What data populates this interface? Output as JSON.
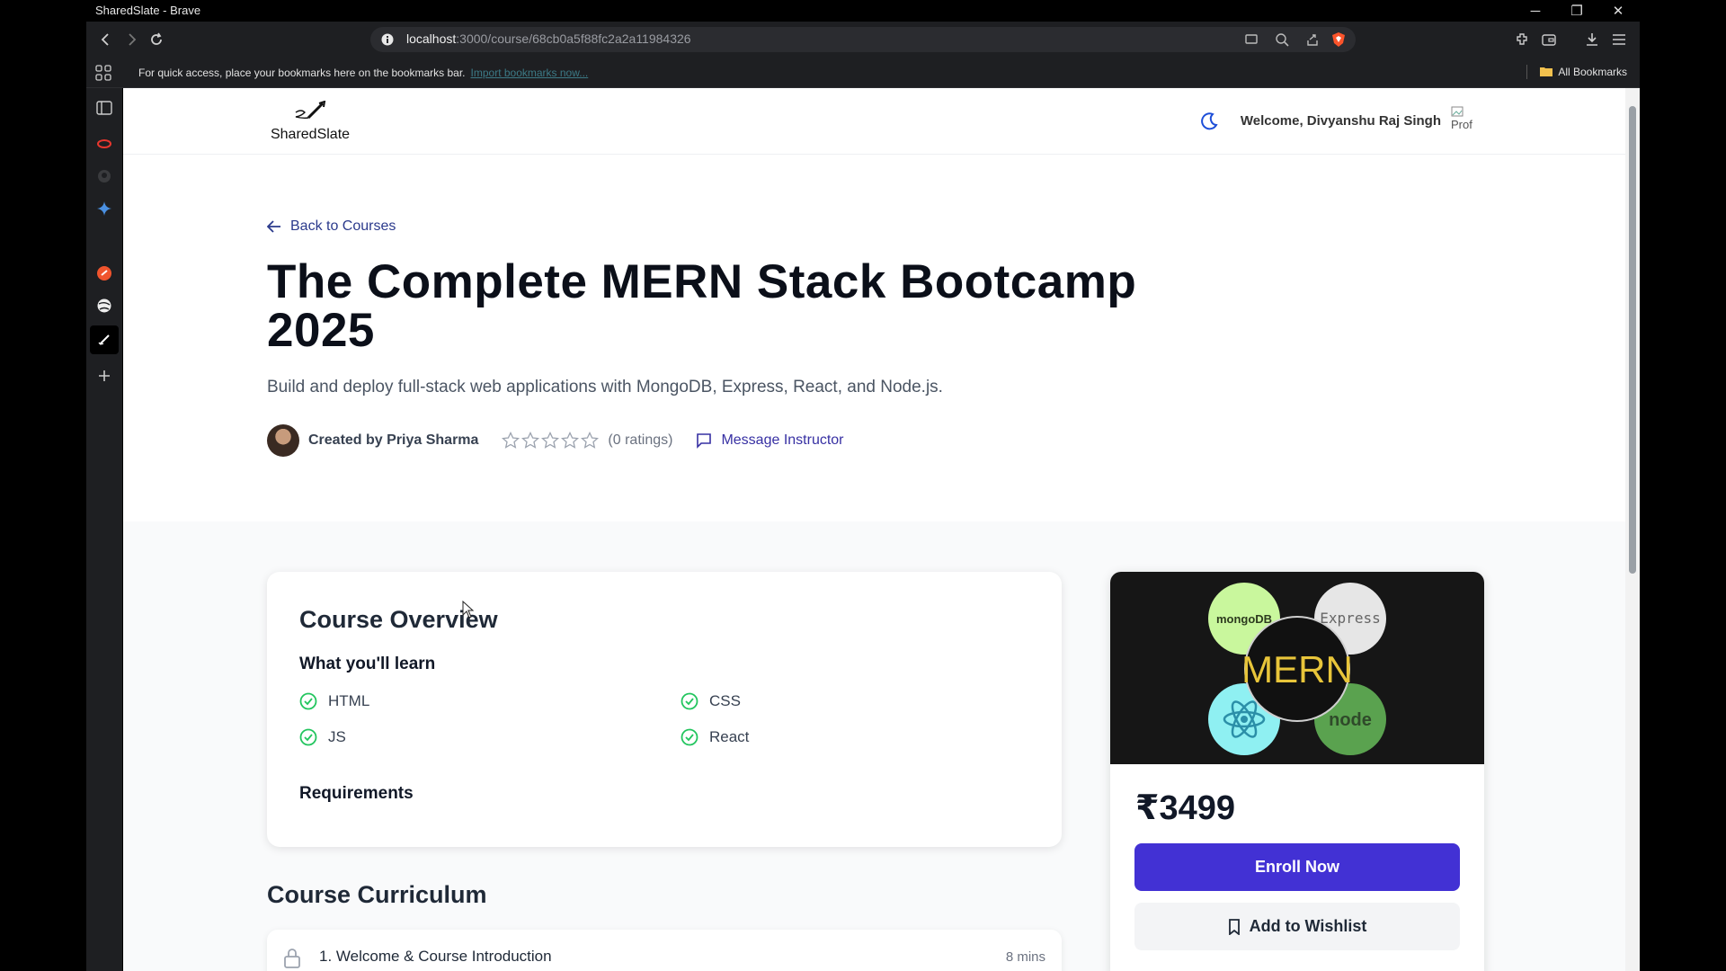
{
  "window": {
    "title": "SharedSlate - Brave",
    "minimize": "─",
    "restore": "❐",
    "close": "✕"
  },
  "browser": {
    "url_host": "localhost",
    "url_path": ":3000/course/68cb0a5f88fc2a2a11984326",
    "bookmarks_prompt": "For quick access, place your bookmarks here on the bookmarks bar.",
    "import_link": "Import bookmarks now...",
    "all_bookmarks": "All Bookmarks"
  },
  "header": {
    "logo_name": "SharedSlate",
    "welcome": "Welcome, Divyanshu Raj Singh",
    "avatar_alt": "Prof"
  },
  "course": {
    "back_label": "Back to Courses",
    "title": "The Complete MERN Stack Bootcamp 2025",
    "subtitle": "Build and deploy full-stack web applications with MongoDB, Express, React, and Node.js.",
    "created_by": "Created by Priya Sharma",
    "ratings_text": "(0 ratings)",
    "rating_stars": 0,
    "message_label": "Message Instructor"
  },
  "overview": {
    "title": "Course Overview",
    "learn_title": "What you'll learn",
    "learn_items": [
      "HTML",
      "CSS",
      "JS",
      "React"
    ],
    "requirements_title": "Requirements"
  },
  "curriculum": {
    "title": "Course Curriculum",
    "lectures": [
      {
        "title": "1. Welcome & Course Introduction",
        "duration": "8 mins"
      }
    ]
  },
  "purchase_card": {
    "thumbnail_labels": {
      "center": "MERN",
      "mongo": "mongoDB",
      "express": "Express",
      "node": "node"
    },
    "price": "₹3499",
    "enroll_label": "Enroll Now",
    "wishlist_label": "Add to Wishlist"
  },
  "colors": {
    "accent": "#4231d4",
    "link": "#3730a3",
    "check": "#22c55e"
  }
}
